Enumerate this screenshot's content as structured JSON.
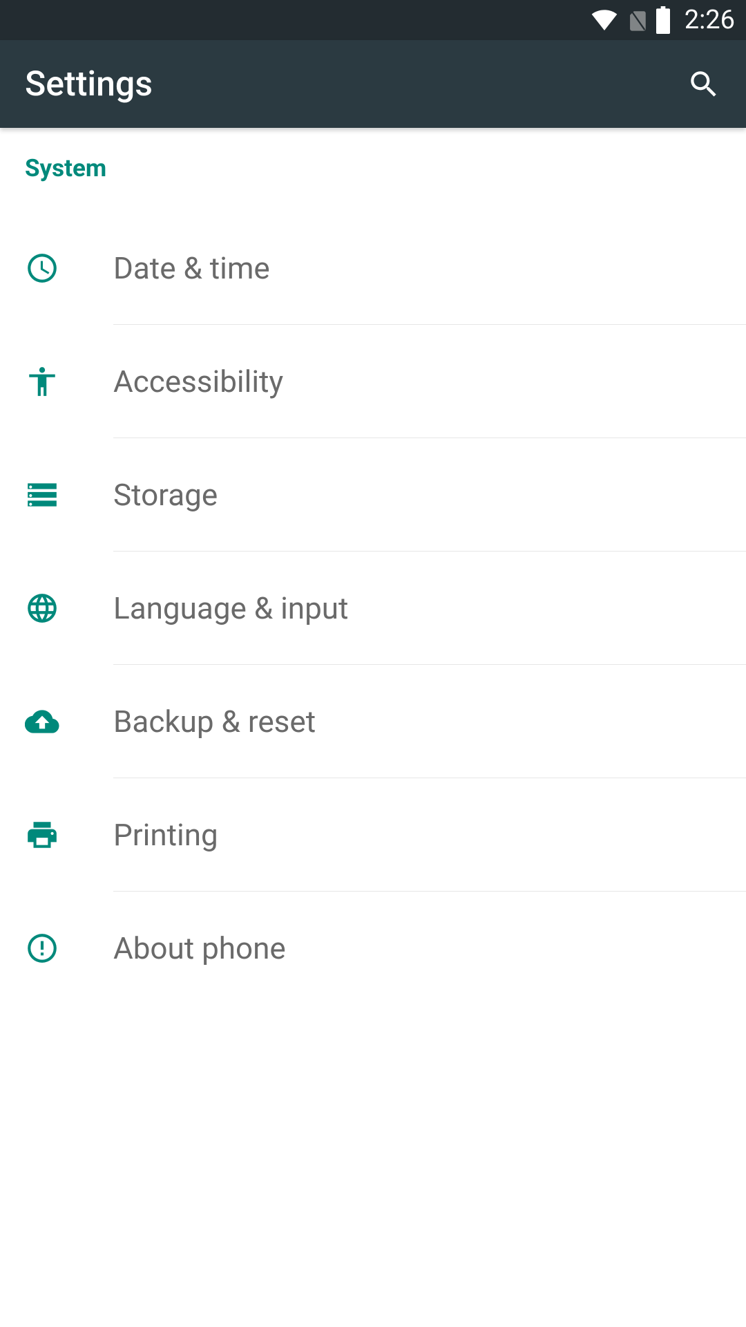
{
  "status_bar": {
    "time": "2:26"
  },
  "toolbar": {
    "title": "Settings"
  },
  "section": {
    "title": "System"
  },
  "list": {
    "items": [
      {
        "icon": "clock-icon",
        "label": "Date & time"
      },
      {
        "icon": "accessibility-icon",
        "label": "Accessibility"
      },
      {
        "icon": "storage-icon",
        "label": "Storage"
      },
      {
        "icon": "globe-icon",
        "label": "Language & input"
      },
      {
        "icon": "cloud-upload-icon",
        "label": "Backup & reset"
      },
      {
        "icon": "printer-icon",
        "label": "Printing"
      },
      {
        "icon": "info-icon",
        "label": "About phone"
      }
    ]
  }
}
